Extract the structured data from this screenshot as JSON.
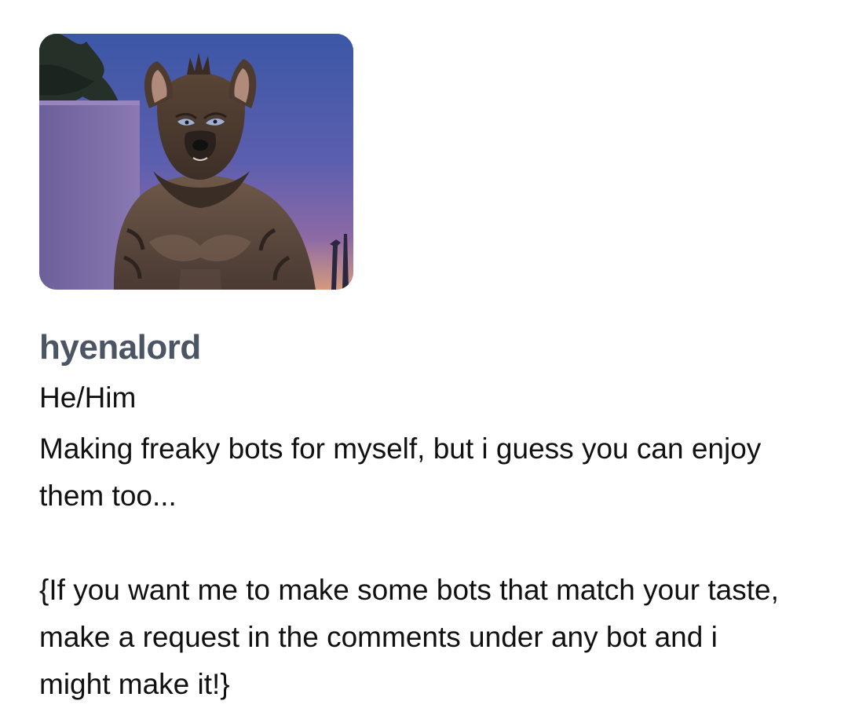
{
  "profile": {
    "avatar_alt": "hyena character avatar",
    "username": "hyenalord",
    "pronouns": "He/Him",
    "bio_line1": "Making freaky bots for myself, but i guess you can enjoy them too...",
    "bio_line2": "{If you want me to make some bots that match your taste, make a request in the comments under any bot and i might make it!}"
  },
  "colors": {
    "username": "#4b5563",
    "text": "#111111",
    "background": "#ffffff"
  }
}
